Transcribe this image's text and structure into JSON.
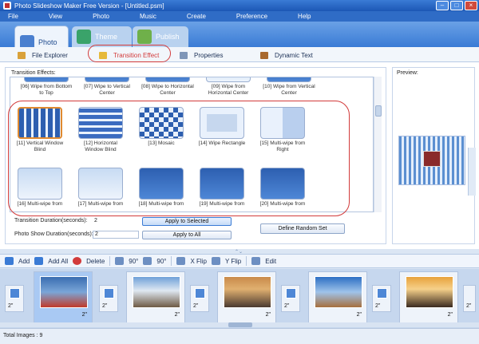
{
  "window": {
    "title": "Photo Slideshow Maker Free Version - [Untitled.psm]"
  },
  "menu": [
    "File",
    "View",
    "Photo",
    "Music",
    "Create",
    "Preference",
    "Help"
  ],
  "tabs": {
    "photo": "Photo",
    "theme": "Theme",
    "publish": "Publish"
  },
  "subtabs": {
    "file_explorer": "File Explorer",
    "transition_effect": "Transition Effect",
    "properties": "Properties",
    "dynamic_text": "Dynamic Text"
  },
  "effects_label": "Transition Effects:",
  "preview_label": "Preview:",
  "effects_top": [
    "[06] Wipe from Bottom to Top",
    "[07] Wipe to Vertical Center",
    "[08] Wipe to Horizontal Center",
    "[09] Wipe from Horizontal Center",
    "[10] Wipe from Vertical Center"
  ],
  "effects_mid": [
    "[11] Vertical Window Blind",
    "[12] Horizontal Window Blind",
    "[13] Mosaic",
    "[14] Wipe Rectangle",
    "[15] Multi-wipe from Right"
  ],
  "effects_bot": [
    "[16] Multi-wipe from",
    "[17] Multi-wipe from",
    "[18] Multi-wipe from",
    "[19] Multi-wipe from",
    "[20] Multi-wipe from"
  ],
  "duration": {
    "transition_label": "Transition Duration(seconds):",
    "transition_value": "2",
    "show_label": "Photo Show Duration(seconds):",
    "show_value": "2",
    "apply_selected": "Apply to Selected",
    "apply_all": "Apply to All",
    "define_random": "Define Random Set"
  },
  "toolbar": {
    "add": "Add",
    "add_all": "Add All",
    "delete": "Delete",
    "rot_left": "90°",
    "rot_right": "90°",
    "x_flip": "X Flip",
    "y_flip": "Y Flip",
    "edit": "Edit"
  },
  "photos": [
    {
      "dur": "2\"",
      "colors": [
        "#3a6db0",
        "#c23a2a"
      ]
    },
    {
      "dur": "2\"",
      "colors": [
        "#6fa0d8",
        "#6e5a44"
      ]
    },
    {
      "dur": "2\"",
      "colors": [
        "#c98a4a",
        "#4a3a30"
      ]
    },
    {
      "dur": "2\"",
      "colors": [
        "#2d6fc4",
        "#a66f3d"
      ]
    },
    {
      "dur": "2\"",
      "colors": [
        "#e7a23b",
        "#3a2a20"
      ]
    }
  ],
  "trans_durs": [
    "2\"",
    "2\"",
    "2\"",
    "2\"",
    "2\"",
    "2\""
  ],
  "status": "Total Images : 9"
}
